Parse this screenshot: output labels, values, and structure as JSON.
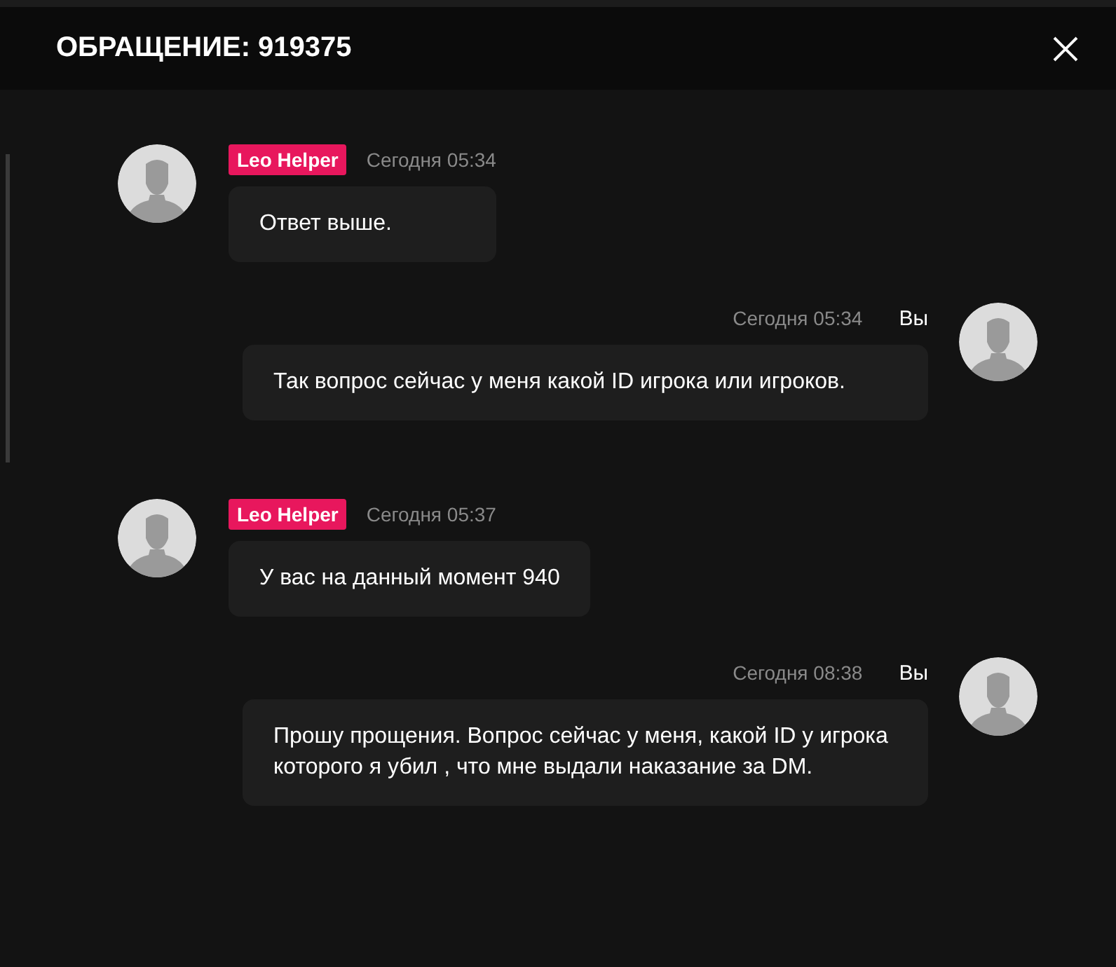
{
  "window": {
    "title": "ОБРАЩЕНИЕ: 919375"
  },
  "messages": [
    {
      "kind": "incoming",
      "author": "Leo Helper",
      "time": "Сегодня 05:34",
      "text": "Ответ выше."
    },
    {
      "kind": "outgoing",
      "author": "Вы",
      "time": "Сегодня 05:34",
      "text": "Так вопрос сейчас у меня какой ID игрока или игроков."
    },
    {
      "kind": "incoming",
      "author": "Leo Helper",
      "time": "Сегодня 05:37",
      "text": "У вас на данный момент 940"
    },
    {
      "kind": "outgoing",
      "author": "Вы",
      "time": "Сегодня 08:38",
      "text": "Прошу прощения. Вопрос сейчас у меня, какой ID у игрока которого я убил , что мне выдали наказание за DM."
    }
  ]
}
